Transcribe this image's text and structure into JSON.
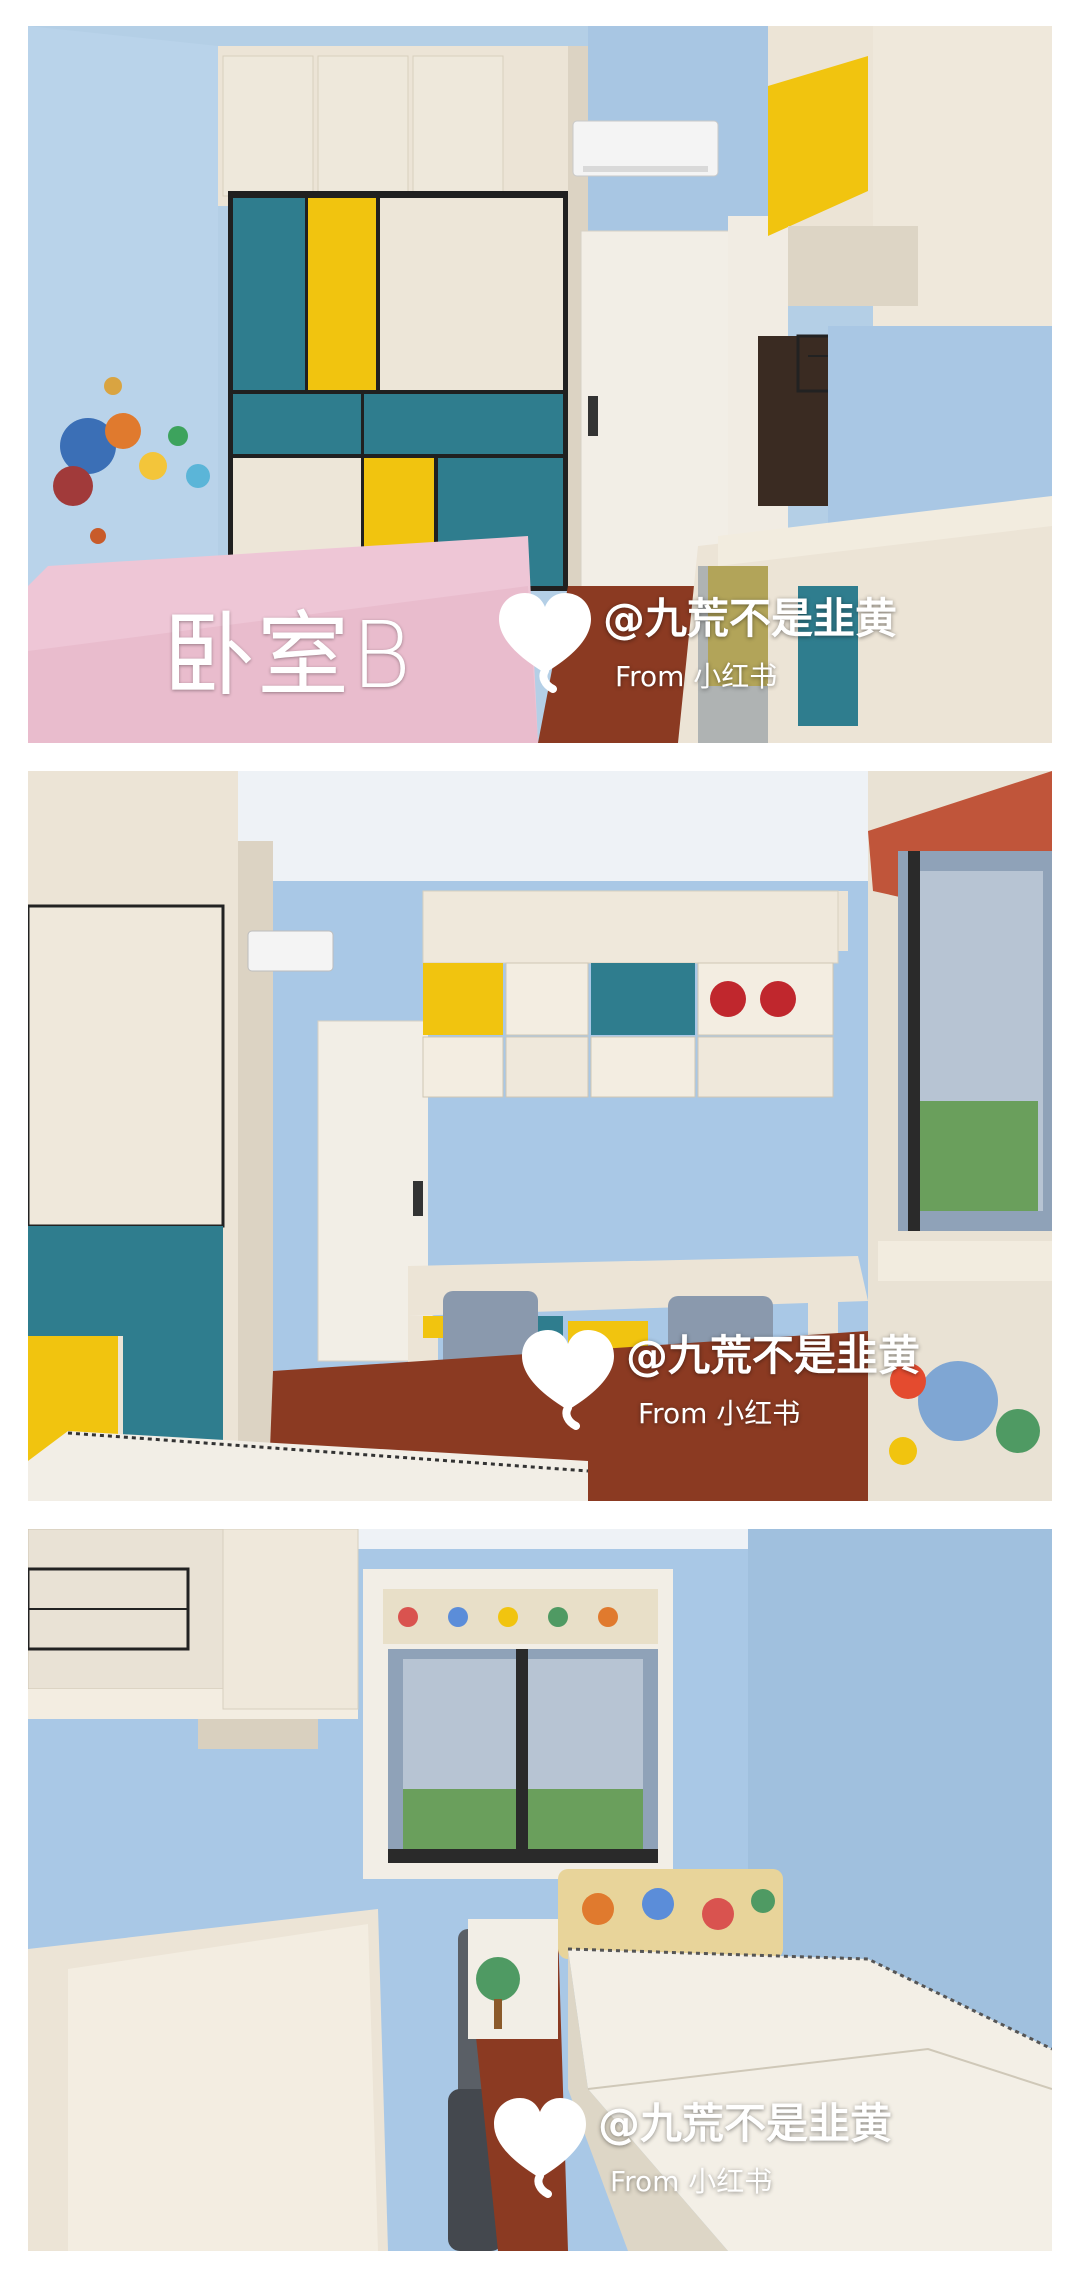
{
  "room_label": "卧室B",
  "watermark": {
    "handle": "@九荒不是韭黄",
    "source": "From 小红书"
  },
  "colors": {
    "wall": "#a9c8e6",
    "cabinet": "#ece4d6",
    "teal": "#2f7d8e",
    "yellow": "#f1c40f",
    "floor": "#8b3a22",
    "mattress_pink": "#eec6d6",
    "door": "#f2eee6"
  },
  "photos": [
    {
      "description_icon": "photo-bedroom-wardrobe"
    },
    {
      "description_icon": "photo-bedroom-desk"
    },
    {
      "description_icon": "photo-bedroom-window-bed"
    }
  ]
}
